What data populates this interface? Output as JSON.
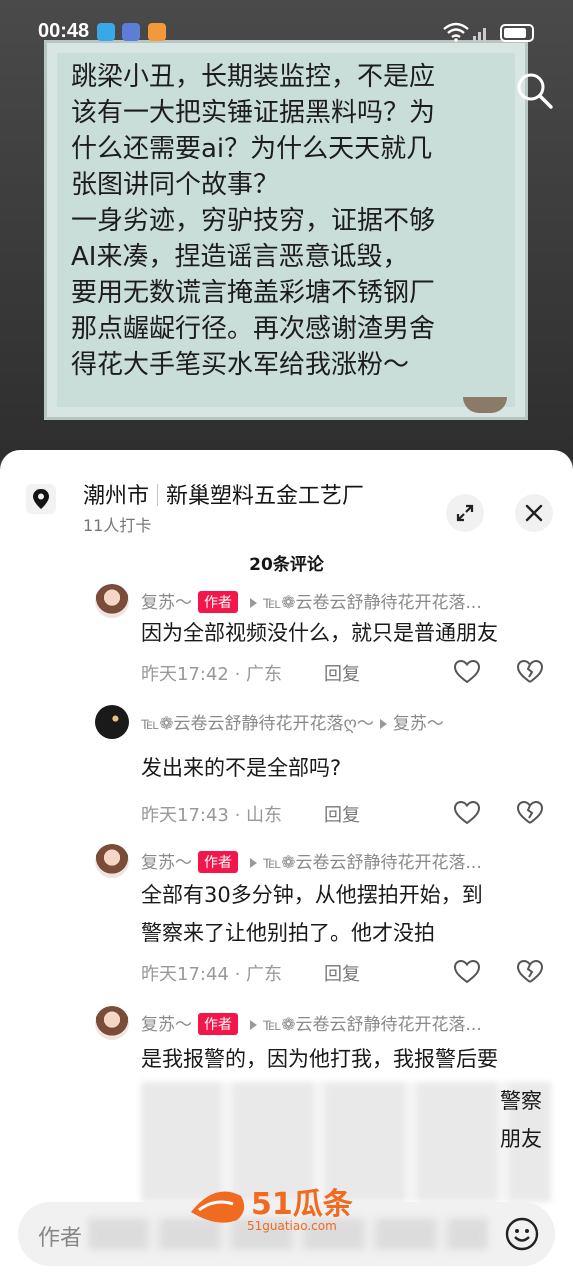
{
  "status_bar": {
    "time": "00:48"
  },
  "video": {
    "note_lines": [
      "跳梁小丑，长期装监控，不是应",
      "该有一大把实锤证据黑料吗？为",
      "什么还需要ai？为什么天天就几",
      "张图讲同个故事？",
      "一身劣迹，穷驴技穷，证据不够",
      "AI来凑，捏造谣言恶意诋毁，",
      "要用无数谎言掩盖彩塘不锈钢厂",
      "那点龌龊行径。再次感谢渣男舍",
      "得花大手笔买水军给我涨粉～"
    ]
  },
  "location": {
    "city": "潮州市",
    "place": "新巢塑料五金工艺厂",
    "checkins": "11人打卡"
  },
  "comments_header": "20条评论",
  "comments": [
    {
      "author": "复苏～",
      "badge": "作者",
      "reply_to": "℡❁云卷云舒静待花开花落...",
      "lines": [
        "因为全部视频没什么，就只是普通朋友"
      ],
      "time": "昨天17:42 · 广东",
      "reply": "回复"
    },
    {
      "author": "℡❁云卷云舒静待花开花落ღ〜",
      "badge": "",
      "reply_to": "复苏～",
      "lines": [
        "发出来的不是全部吗?"
      ],
      "time": "昨天17:43 · 山东",
      "reply": "回复"
    },
    {
      "author": "复苏～",
      "badge": "作者",
      "reply_to": "℡❁云卷云舒静待花开花落...",
      "lines": [
        "全部有30多分钟，从他摆拍开始，到",
        "警察来了让他别拍了。他才没拍"
      ],
      "time": "昨天17:44 · 广东",
      "reply": "回复"
    },
    {
      "author": "复苏～",
      "badge": "作者",
      "reply_to": "℡❁云卷云舒静待花开花落...",
      "lines": [
        "是我报警的，因为他打我，我报警后要"
      ],
      "visible_tail": [
        "警察",
        "朋友"
      ],
      "time": "",
      "reply": ""
    }
  ],
  "input": {
    "placeholder": "作者"
  },
  "watermark": {
    "brand": "51瓜条",
    "domain": "51guatiao.com"
  },
  "colors": {
    "badge": "#f3164a",
    "watermark": "#f06a20"
  }
}
